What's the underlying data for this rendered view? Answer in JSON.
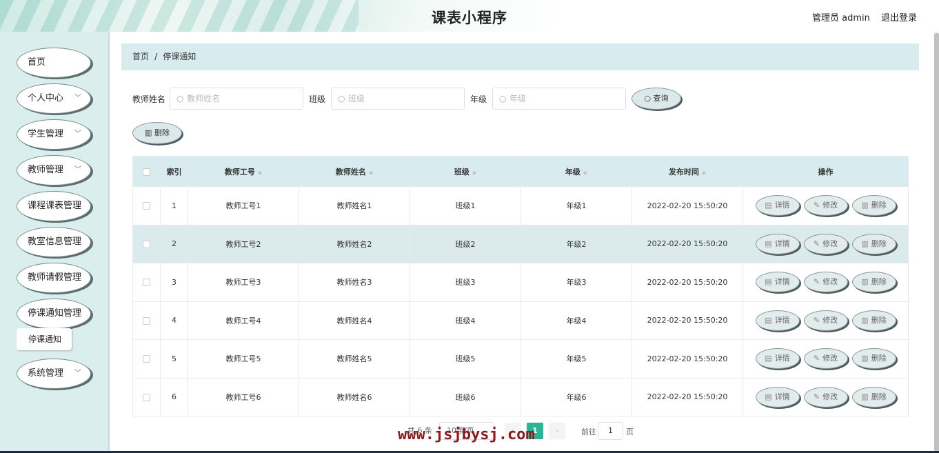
{
  "header": {
    "title": "课表小程序",
    "user": "管理员 admin",
    "logout": "退出登录"
  },
  "sidebar": {
    "items": [
      {
        "label": "首页",
        "has_chevron": false
      },
      {
        "label": "个人中心",
        "has_chevron": true
      },
      {
        "label": "学生管理",
        "has_chevron": true
      },
      {
        "label": "教师管理",
        "has_chevron": true
      },
      {
        "label": "课程课表管理",
        "has_chevron": true
      },
      {
        "label": "教室信息管理",
        "has_chevron": true
      },
      {
        "label": "教师请假管理",
        "has_chevron": true
      },
      {
        "label": "停课通知管理",
        "has_chevron": true
      },
      {
        "label": "系统管理",
        "has_chevron": true
      }
    ],
    "submenu": "停课通知"
  },
  "breadcrumb": {
    "home": "首页",
    "separator": "/",
    "current": "停课通知"
  },
  "search": {
    "teacher_name_label": "教师姓名",
    "teacher_name_placeholder": "教师姓名",
    "class_label": "班级",
    "class_placeholder": "班级",
    "grade_label": "年级",
    "grade_placeholder": "年级",
    "query_button": "查询",
    "delete_button": "删除"
  },
  "table": {
    "columns": [
      "索引",
      "教师工号",
      "教师姓名",
      "班级",
      "年级",
      "发布时间",
      "操作"
    ],
    "rows": [
      {
        "index": "1",
        "teacher_id": "教师工号1",
        "teacher_name": "教师姓名1",
        "class": "班级1",
        "grade": "年级1",
        "time": "2022-02-20 15:50:20"
      },
      {
        "index": "2",
        "teacher_id": "教师工号2",
        "teacher_name": "教师姓名2",
        "class": "班级2",
        "grade": "年级2",
        "time": "2022-02-20 15:50:20"
      },
      {
        "index": "3",
        "teacher_id": "教师工号3",
        "teacher_name": "教师姓名3",
        "class": "班级3",
        "grade": "年级3",
        "time": "2022-02-20 15:50:20"
      },
      {
        "index": "4",
        "teacher_id": "教师工号4",
        "teacher_name": "教师姓名4",
        "class": "班级4",
        "grade": "年级4",
        "time": "2022-02-20 15:50:20"
      },
      {
        "index": "5",
        "teacher_id": "教师工号5",
        "teacher_name": "教师姓名5",
        "class": "班级5",
        "grade": "年级5",
        "time": "2022-02-20 15:50:20"
      },
      {
        "index": "6",
        "teacher_id": "教师工号6",
        "teacher_name": "教师姓名6",
        "class": "班级6",
        "grade": "年级6",
        "time": "2022-02-20 15:50:20"
      }
    ],
    "actions": {
      "detail": "详情",
      "edit": "修改",
      "delete": "删除"
    }
  },
  "pagination": {
    "total": "共 6 条",
    "page_size": "10条/页",
    "current_page": "1",
    "goto_label": "前往",
    "goto_value": "1",
    "page_suffix": "页"
  },
  "watermark": "www.jsjbysj.com",
  "colors": {
    "accent": "#2bb596",
    "sidebar_bg": "#dbeeee",
    "header_row_bg": "#d8ebee",
    "watermark": "#8b1a1a"
  },
  "icons": {
    "search": "search-icon",
    "delete": "trash-icon",
    "detail": "document-icon",
    "edit": "pencil-icon",
    "chevron": "chevron-down-icon"
  }
}
